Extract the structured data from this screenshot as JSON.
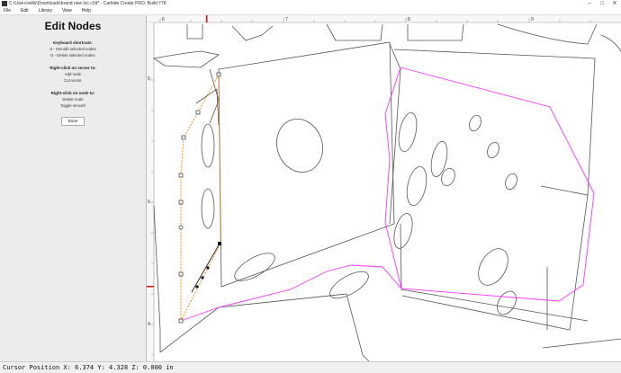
{
  "window": {
    "title": "C:\\Users\\wills\\Downloads\\brand new loc.c2d* - Carbide Create PRO, Build 778",
    "controls": [
      "–",
      "□",
      "✕"
    ]
  },
  "menu": [
    "File",
    "Edit",
    "Library",
    "View",
    "Help"
  ],
  "sidebar": {
    "title": "Edit Nodes",
    "keyboard_heading": "Keyboard shortcuts:",
    "keyboard_lines": [
      "S - Smooth selected nodes",
      "D - Delete selected nodes"
    ],
    "vector_heading": "Right-click on vector to:",
    "vector_lines": [
      "Add node",
      "Cut vector"
    ],
    "node_heading": "Right-click on node to:",
    "node_lines": [
      "Delete node",
      "Toggle smooth"
    ],
    "done_label": "Done"
  },
  "ruler": {
    "x_labels": [
      "6",
      "7",
      "8",
      "9"
    ],
    "y_labels": [
      "6",
      "5",
      "4"
    ]
  },
  "status": {
    "text": "Cursor Position X: 6.374 Y: 4.328 Z: 0.000 in"
  },
  "colors": {
    "selected_path": "#ff7f00",
    "secondary_path": "#ff33ff",
    "vector_lines": "#555555",
    "ruler_marker": "#e8000b"
  },
  "icons": {
    "app": "carbide-create-icon"
  }
}
